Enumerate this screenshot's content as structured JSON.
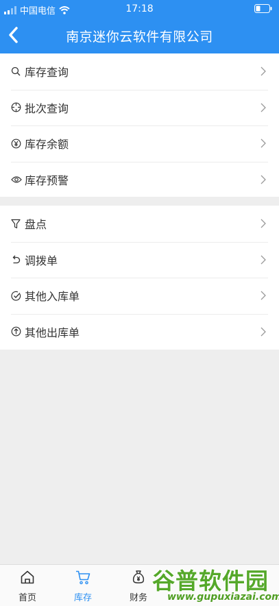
{
  "status_bar": {
    "carrier": "中国电信",
    "time": "17:18"
  },
  "header": {
    "title": "南京迷你云软件有限公司"
  },
  "menu_groups": [
    {
      "items": [
        {
          "label": "库存查询",
          "icon": "search-icon"
        },
        {
          "label": "批次查询",
          "icon": "crosshair-icon"
        },
        {
          "label": "库存余额",
          "icon": "yen-circle-icon"
        },
        {
          "label": "库存预警",
          "icon": "eye-icon"
        }
      ]
    },
    {
      "items": [
        {
          "label": "盘点",
          "icon": "funnel-icon"
        },
        {
          "label": "调拨单",
          "icon": "undo-icon"
        },
        {
          "label": "其他入库单",
          "icon": "check-circle-icon"
        },
        {
          "label": "其他出库单",
          "icon": "arrow-up-circle-icon"
        }
      ]
    }
  ],
  "tabbar": {
    "tabs": [
      {
        "label": "首页",
        "icon": "home-icon",
        "active": false
      },
      {
        "label": "库存",
        "icon": "cart-icon",
        "active": true
      },
      {
        "label": "财务",
        "icon": "money-bag-icon",
        "active": false
      }
    ]
  },
  "watermark": {
    "name": "谷普软件园",
    "url": "www.gupuxiazai.com"
  },
  "colors": {
    "primary": "#2d90f2",
    "background": "#eeeeee",
    "watermark": "#55a82a"
  }
}
